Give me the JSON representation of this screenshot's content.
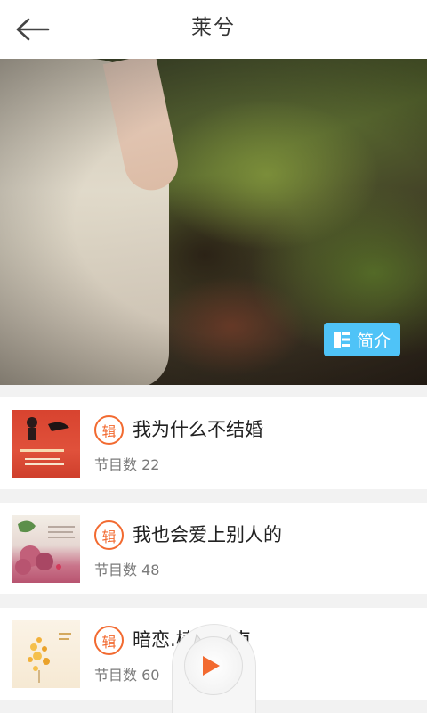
{
  "header": {
    "title": "莱兮",
    "back_icon": "arrow-left-icon"
  },
  "hero": {
    "intro_label": "简介",
    "intro_icon": "list-icon",
    "accent": "#4fc3f7"
  },
  "albums": [
    {
      "badge": "辑",
      "title": "我为什么不结婚",
      "count_label": "节目数",
      "count": "22"
    },
    {
      "badge": "辑",
      "title": "我也会爱上别人的",
      "count_label": "节目数",
      "count": "48"
    },
    {
      "badge": "辑",
      "title": "暗恋.椿。北南",
      "count_label": "节目数",
      "count": "60"
    }
  ],
  "player": {
    "icon": "play-icon",
    "accent": "#f26a30"
  }
}
